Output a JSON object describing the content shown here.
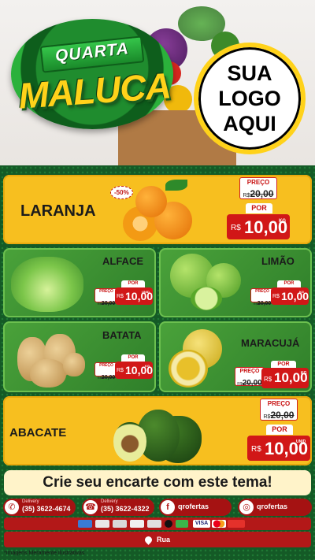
{
  "header": {
    "badge_top": "QUARTA",
    "badge_main": "MALUCA",
    "logo_lines": [
      "SUA",
      "LOGO",
      "AQUI"
    ]
  },
  "products": [
    {
      "name": "LARANJA",
      "badge": "-50%",
      "tag_label": "PREÇO",
      "old_currency": "R$",
      "old_price": "20,00",
      "por_label": "POR",
      "new_currency": "R$",
      "new_price": "10,00",
      "unit": "KG"
    },
    {
      "name": "ALFACE",
      "tag_label": "PREÇO",
      "old_currency": "R$",
      "old_price": "20,00",
      "por_label": "POR",
      "new_currency": "R$",
      "new_price": "10,00",
      "unit": "UNID"
    },
    {
      "name": "LIMÃO",
      "tag_label": "PREÇO",
      "old_currency": "R$",
      "old_price": "20,00",
      "por_label": "POR",
      "new_currency": "R$",
      "new_price": "10,00",
      "unit": "KG"
    },
    {
      "name": "BATATA",
      "tag_label": "PREÇO",
      "old_currency": "R$",
      "old_price": "20,00",
      "por_label": "POR",
      "new_currency": "R$",
      "new_price": "10,00",
      "unit": "KG"
    },
    {
      "name": "MARACUJÁ",
      "tag_label": "PREÇO",
      "old_currency": "R$",
      "old_price": "20,00",
      "por_label": "POR",
      "new_currency": "R$",
      "new_price": "10,00",
      "unit": "KG"
    },
    {
      "name": "ABACATE",
      "tag_label": "PREÇO",
      "old_currency": "R$",
      "old_price": "20,00",
      "por_label": "POR",
      "new_currency": "R$",
      "new_price": "10,00",
      "unit": "UNID"
    }
  ],
  "cta": "Crie seu encarte com este tema!",
  "contacts": {
    "whatsapp": {
      "label": "Delivery",
      "number": "(35) 3622-4674",
      "icon": "whatsapp-icon"
    },
    "phone": {
      "label": "Delivery",
      "number": "(35) 3622-4322",
      "icon": "phone-icon"
    },
    "facebook": {
      "handle": "qrofertas",
      "icon": "facebook-icon"
    },
    "instagram": {
      "handle": "qrofertas",
      "icon": "instagram-icon"
    }
  },
  "payments": {
    "visa": "VISA"
  },
  "address": "Rua",
  "disclaimer": "*Imagens Meramente Ilustrativas",
  "colors": {
    "yellow_card": "#f7bf1f",
    "green_board": "#176a2c",
    "price_red": "#d11717",
    "footer_red": "#a51212"
  }
}
